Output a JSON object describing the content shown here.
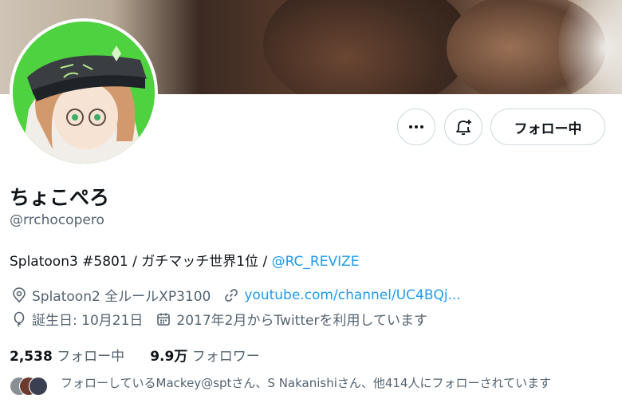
{
  "profile": {
    "display_name": "ちょこぺろ",
    "handle": "@rrchocopero",
    "bio_text": "Splatoon3 #5801 / ガチマッチ世界1位 / ",
    "bio_mention": "@RC_REVIZE",
    "location": "Splatoon2 全ルールXP3100",
    "website": "youtube.com/channel/UC4BQj...",
    "birthday": "誕生日: 10月21日",
    "joined": "2017年2月からTwitterを利用しています"
  },
  "actions": {
    "more_icon": "more-icon",
    "notify_icon": "bell-plus-icon",
    "follow_label": "フォロー中"
  },
  "stats": {
    "following_count": "2,538",
    "following_label": "フォロー中",
    "followers_count": "9.9万",
    "followers_label": "フォロワー"
  },
  "followed_by": {
    "text": "フォローしているMackey@sptさん、S Nakanishiさん、他414人にフォローされています"
  },
  "colors": {
    "accent": "#1d9bf0",
    "muted": "#536471",
    "avatar_bg": "#4fd23f"
  }
}
